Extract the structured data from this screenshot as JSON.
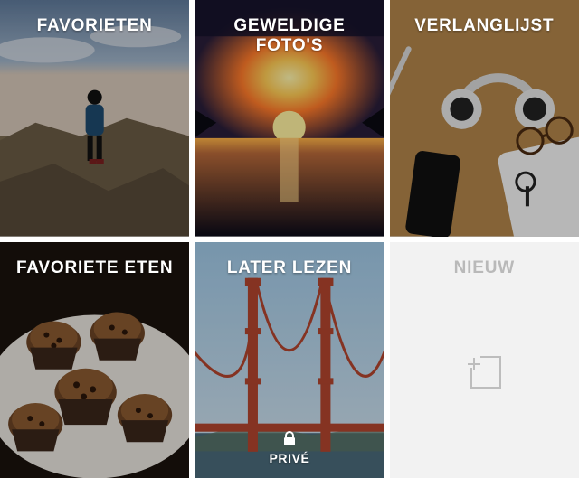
{
  "tiles": [
    {
      "title": "FAVORIETEN"
    },
    {
      "title": "GEWELDIGE\nFOTO'S"
    },
    {
      "title": "VERLANGLIJST"
    },
    {
      "title": "FAVORIETE ETEN"
    },
    {
      "title": "LATER LEZEN",
      "private_label": "PRIVÉ"
    },
    {
      "title": "NIEUW"
    }
  ]
}
